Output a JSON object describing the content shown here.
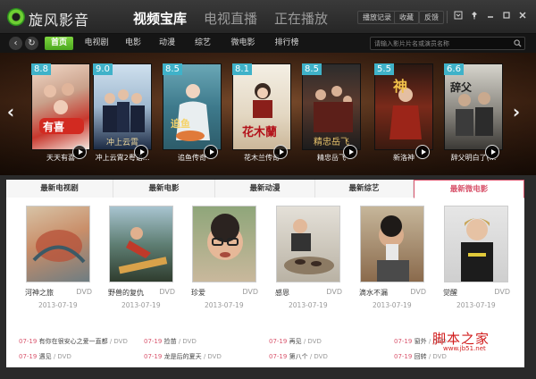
{
  "app": {
    "name": "旋风影音"
  },
  "header": {
    "tabs": [
      {
        "label": "视频宝库",
        "active": true
      },
      {
        "label": "电视直播",
        "active": false
      },
      {
        "label": "正在播放",
        "active": false
      }
    ],
    "buttons": [
      "播放记录",
      "收藏",
      "反馈"
    ]
  },
  "nav": {
    "categories": [
      {
        "label": "首页",
        "active": true
      },
      {
        "label": "电视剧"
      },
      {
        "label": "电影"
      },
      {
        "label": "动漫"
      },
      {
        "label": "综艺"
      },
      {
        "label": "微电影"
      },
      {
        "label": "排行榜"
      }
    ],
    "search_placeholder": "请输入影片片名或演员名称"
  },
  "carousel": [
    {
      "score": "8.8",
      "title": "天天有喜"
    },
    {
      "score": "9.0",
      "title": "冲上云霄2粤语..."
    },
    {
      "score": "8.5",
      "title": "追鱼传奇"
    },
    {
      "score": "8.1",
      "title": "花木兰传奇"
    },
    {
      "score": "8.5",
      "title": "精忠岳飞"
    },
    {
      "score": "5.5",
      "title": "新洛神"
    },
    {
      "score": "6.6",
      "title": "辞父明白了(..."
    }
  ],
  "section_tabs": [
    {
      "label": "最新电视剧"
    },
    {
      "label": "最新电影"
    },
    {
      "label": "最新动漫"
    },
    {
      "label": "最新综艺"
    },
    {
      "label": "最新微电影",
      "active": true
    }
  ],
  "films": [
    {
      "title": "河神之旅",
      "badge": "DVD",
      "date": "2013-07-19"
    },
    {
      "title": "野兽的复仇",
      "badge": "DVD",
      "date": "2013-07-19"
    },
    {
      "title": "珍爱",
      "badge": "DVD",
      "date": "2013-07-19"
    },
    {
      "title": "感恩",
      "badge": "DVD",
      "date": "2013-07-19"
    },
    {
      "title": "滴水不漏",
      "badge": "DVD",
      "date": "2013-07-19"
    },
    {
      "title": "觉醒",
      "badge": "DVD",
      "date": "2013-07-19"
    }
  ],
  "list": [
    [
      {
        "date": "07-19",
        "title": "有你在很安心之爱一直都",
        "badge": "DVD"
      },
      {
        "date": "07-19",
        "title": "捡苗",
        "badge": "DVD"
      },
      {
        "date": "07-19",
        "title": "再见",
        "badge": "DVD"
      },
      {
        "date": "07-19",
        "title": "窗外",
        "badge": "DVD"
      }
    ],
    [
      {
        "date": "07-19",
        "title": "遇见",
        "badge": "DVD"
      },
      {
        "date": "07-19",
        "title": "龙是后的夏天",
        "badge": "DVD"
      },
      {
        "date": "07-19",
        "title": "第八个",
        "badge": "DVD"
      },
      {
        "date": "07-19",
        "title": "回转",
        "badge": "DVD"
      }
    ]
  ],
  "watermark": {
    "text": "脚本之家",
    "url": "www.jb51.net"
  },
  "colors": {
    "accent_green": "#5cb82a",
    "accent_pink": "#d9556d",
    "score_badge": "#3fb2c9"
  }
}
